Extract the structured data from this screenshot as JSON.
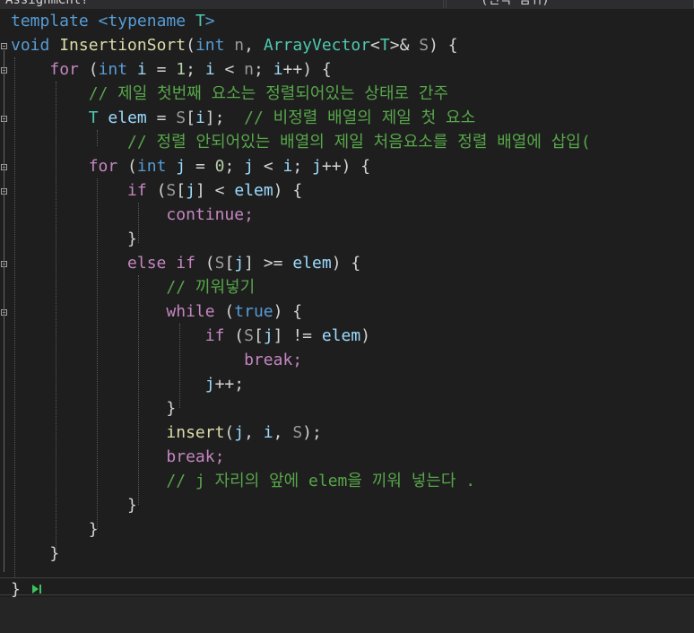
{
  "tabs": [
    {
      "label": "Assignment?"
    },
    {
      "label": "(전역 범위)"
    }
  ],
  "code_lines": [
    "template <typename T>",
    "void InsertionSort(int n, ArrayVector<T>& S) {",
    "    for (int i = 1; i < n; i++) {",
    "        // 제일 첫번째 요소는 정렬되어있는 상태로 간주",
    "        T elem = S[i];  // 비정렬 배열의 제일 첫 요소",
    "            // 정렬 안되어있는 배열의 제일 처음요소를 정렬 배열에 삽입(",
    "        for (int j = 0; j < i; j++) {",
    "            if (S[j] < elem) {",
    "                continue;",
    "            }",
    "            else if (S[j] >= elem) {",
    "                // 끼워넣기",
    "                while (true) {",
    "                    if (S[j] != elem)",
    "                        break;",
    "                    j++;",
    "                }",
    "                insert(j, i, S);",
    "                break;",
    "                // j 자리의 앞에 elem을 끼워 넣는다 .",
    "            }",
    "        }",
    "    }",
    "}"
  ],
  "colors": {
    "background": "#1e1e1e",
    "keyword": "#569cd6",
    "control_keyword": "#c586c0",
    "type": "#4ec9b0",
    "function": "#dcdcaa",
    "variable": "#9cdcfe",
    "number": "#b5cea8",
    "comment": "#57a64a",
    "text": "#d4d4d4"
  }
}
